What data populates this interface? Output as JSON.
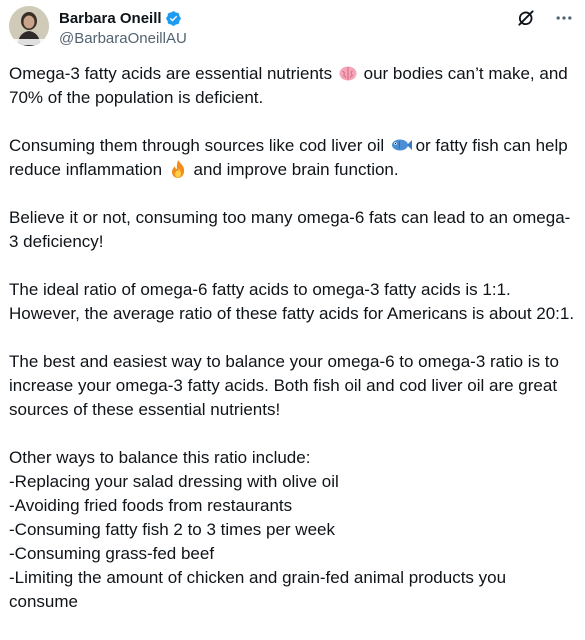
{
  "author": {
    "display_name": "Barbara Oneill",
    "handle": "@BarbaraOneillAU",
    "avatar_caption": "Barbara O'Neill"
  },
  "icons": {
    "verified": "verified-badge-icon",
    "grok": "grok-icon",
    "more": "more-icon",
    "brain": "brain-emoji",
    "fish": "fish-emoji",
    "fire": "fire-emoji"
  },
  "colors": {
    "verified_blue": "#1d9bf0",
    "text": "#0f1419",
    "secondary_text": "#536471"
  },
  "tweet": {
    "p1_before": "Omega-3 fatty acids are essential nutrients ",
    "p1_after": " our bodies can’t make, and 70% of the population is deficient.",
    "p2_before": "Consuming them through sources like cod liver oil ",
    "p2_middle": " or fatty fish can help reduce inflammation ",
    "p2_after": " and improve brain function.",
    "p3": "Believe it or not, consuming too many omega-6 fats can lead to an omega-3 deficiency!",
    "p4": "The ideal ratio of omega-6 fatty acids to omega-3 fatty acids is 1:1. However, the average ratio of these fatty acids for Americans is about 20:1.",
    "p5": "The best and easiest way to balance your omega-6 to omega-3 ratio is to increase your omega-3 fatty acids. Both fish oil and cod liver oil are great sources of these essential nutrients!",
    "list_intro": "Other ways to balance this ratio include:",
    "list_items": [
      "-Replacing your salad dressing with olive oil",
      "-Avoiding fried foods from restaurants",
      "-Consuming fatty fish 2 to 3 times per week",
      "-Consuming grass-fed beef",
      "-Limiting the amount of chicken and grain-fed animal products you consume"
    ]
  }
}
